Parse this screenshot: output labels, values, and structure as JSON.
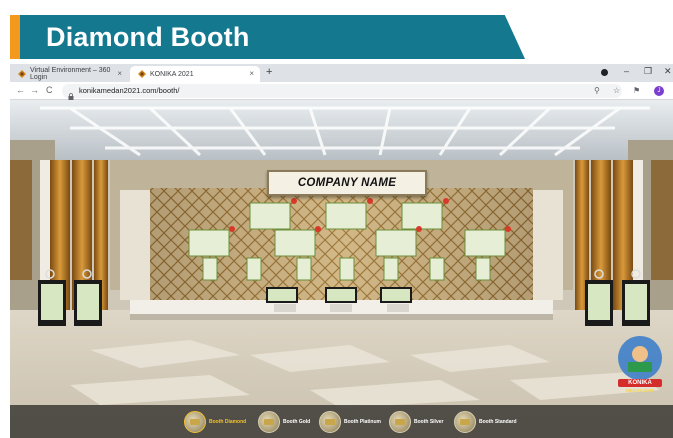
{
  "slide": {
    "title": "Diamond Booth"
  },
  "browser": {
    "tabs": [
      {
        "label": "Virtual Environment – 360 Login",
        "active": false
      },
      {
        "label": "KONIKA 2021",
        "active": true
      }
    ],
    "new_tab_symbol": "+",
    "close_symbol": "×",
    "window_controls": {
      "minimize": "–",
      "restore": "❐",
      "close": "✕"
    },
    "nav": {
      "back": "←",
      "forward": "→",
      "reload": "C"
    },
    "address": "konikamedan2021.com/booth/",
    "profile_initial": "J"
  },
  "scene": {
    "company_sign": "COMPANY NAME",
    "mascot_label": "KONIKA",
    "mascot_year": "MEDAN 2021"
  },
  "booth_nav": [
    {
      "label": "Booth Diamond",
      "active": true
    },
    {
      "label": "Booth Gold",
      "active": false
    },
    {
      "label": "Booth Platinum",
      "active": false
    },
    {
      "label": "Booth Silver",
      "active": false
    },
    {
      "label": "Booth Standard",
      "active": false
    }
  ],
  "colors": {
    "banner_teal": "#14788f",
    "banner_orange": "#f39a1e",
    "active_nav": "#f2c230"
  }
}
